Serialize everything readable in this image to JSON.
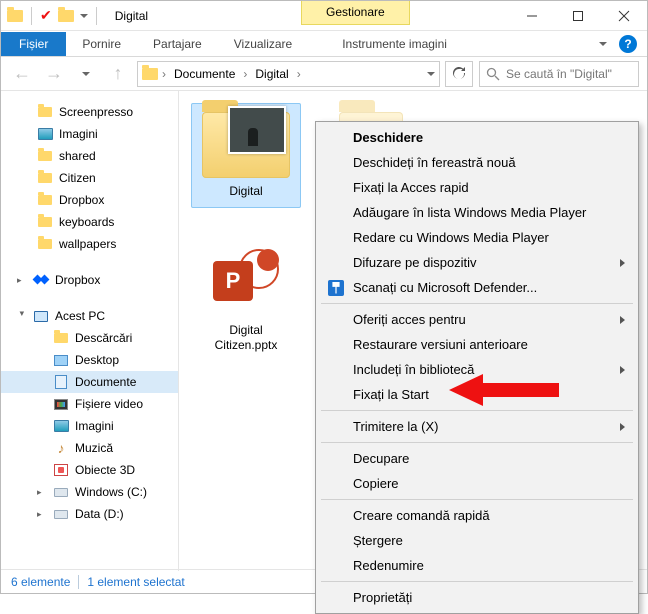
{
  "window": {
    "title": "Digital",
    "context_tab_group": "Gestionare"
  },
  "tabs": {
    "file": "Fișier",
    "home": "Pornire",
    "share": "Partajare",
    "view": "Vizualizare",
    "context": "Instrumente imagini"
  },
  "breadcrumb": {
    "items": [
      "Documente",
      "Digital"
    ]
  },
  "search": {
    "placeholder": "Se caută în \"Digital\""
  },
  "tree": {
    "quick": [
      {
        "label": "Screenpresso",
        "icon": "folder"
      },
      {
        "label": "Imagini",
        "icon": "pictures"
      },
      {
        "label": "shared",
        "icon": "folder"
      },
      {
        "label": "Citizen",
        "icon": "folder"
      },
      {
        "label": "Dropbox",
        "icon": "folder"
      },
      {
        "label": "keyboards",
        "icon": "folder"
      },
      {
        "label": "wallpapers",
        "icon": "folder"
      }
    ],
    "dropbox_root": "Dropbox",
    "pc_root": "Acest PC",
    "pc": [
      {
        "label": "Descărcări",
        "icon": "download"
      },
      {
        "label": "Desktop",
        "icon": "desktop"
      },
      {
        "label": "Documente",
        "icon": "doc",
        "selected": true
      },
      {
        "label": "Fișiere video",
        "icon": "video"
      },
      {
        "label": "Imagini",
        "icon": "pictures"
      },
      {
        "label": "Muzică",
        "icon": "music"
      },
      {
        "label": "Obiecte 3D",
        "icon": "obj3d"
      },
      {
        "label": "Windows (C:)",
        "icon": "drive"
      },
      {
        "label": "Data (D:)",
        "icon": "drive"
      }
    ]
  },
  "content": {
    "folder": {
      "label": "Digital"
    },
    "file": {
      "label": "Digital Citizen.pptx"
    }
  },
  "context_menu": {
    "items": [
      {
        "label": "Deschidere",
        "default": true
      },
      {
        "label": "Deschideți în fereastră nouă"
      },
      {
        "label": "Fixați la Acces rapid"
      },
      {
        "label": "Adăugare în lista Windows Media Player"
      },
      {
        "label": "Redare cu Windows Media Player"
      },
      {
        "label": "Difuzare pe dispozitiv",
        "submenu": true
      },
      {
        "label": "Scanați cu Microsoft Defender...",
        "icon": "shield"
      },
      {
        "sep": true
      },
      {
        "label": "Oferiți acces pentru",
        "submenu": true
      },
      {
        "label": "Restaurare versiuni anterioare"
      },
      {
        "label": "Includeți în bibliotecă",
        "submenu": true
      },
      {
        "label": "Fixați la Start"
      },
      {
        "sep": true
      },
      {
        "label": "Trimitere la (X)",
        "submenu": true
      },
      {
        "sep": true
      },
      {
        "label": "Decupare"
      },
      {
        "label": "Copiere"
      },
      {
        "sep": true
      },
      {
        "label": "Creare comandă rapidă"
      },
      {
        "label": "Ștergere"
      },
      {
        "label": "Redenumire"
      },
      {
        "sep": true
      },
      {
        "label": "Proprietăți"
      }
    ]
  },
  "status": {
    "count": "6 elemente",
    "selected": "1 element selectat"
  }
}
